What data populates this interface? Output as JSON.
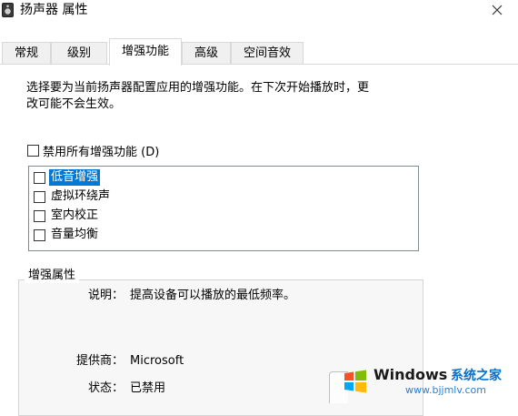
{
  "window": {
    "title": "扬声器 属性"
  },
  "tabs": [
    {
      "label": "常规"
    },
    {
      "label": "级别"
    },
    {
      "label": "增强功能"
    },
    {
      "label": "高级"
    },
    {
      "label": "空间音效"
    }
  ],
  "panel": {
    "description_line1": "选择要为当前扬声器配置应用的增强功能。在下次开始播放时，更",
    "description_line2": "改可能不会生效。",
    "disable_all_label": "禁用所有增强功能 (D)",
    "enhancements": [
      {
        "label": "低音增强",
        "checked": false,
        "selected": true
      },
      {
        "label": "虚拟环绕声",
        "checked": false,
        "selected": false
      },
      {
        "label": "室内校正",
        "checked": false,
        "selected": false
      },
      {
        "label": "音量均衡",
        "checked": false,
        "selected": false
      }
    ],
    "properties": {
      "title": "增强属性",
      "description_key": "说明：",
      "description_value": "提高设备可以播放的最低频率。",
      "provider_key": "提供商：",
      "provider_value": "Microsoft",
      "status_key": "状态：",
      "status_value": "已禁用"
    }
  },
  "watermark": {
    "brand": "Windows",
    "cn": "系统之家",
    "url": "www.bjjmlv.com"
  },
  "colors": {
    "selection": "#0078d7",
    "accent_blue": "#0b6fc6"
  }
}
